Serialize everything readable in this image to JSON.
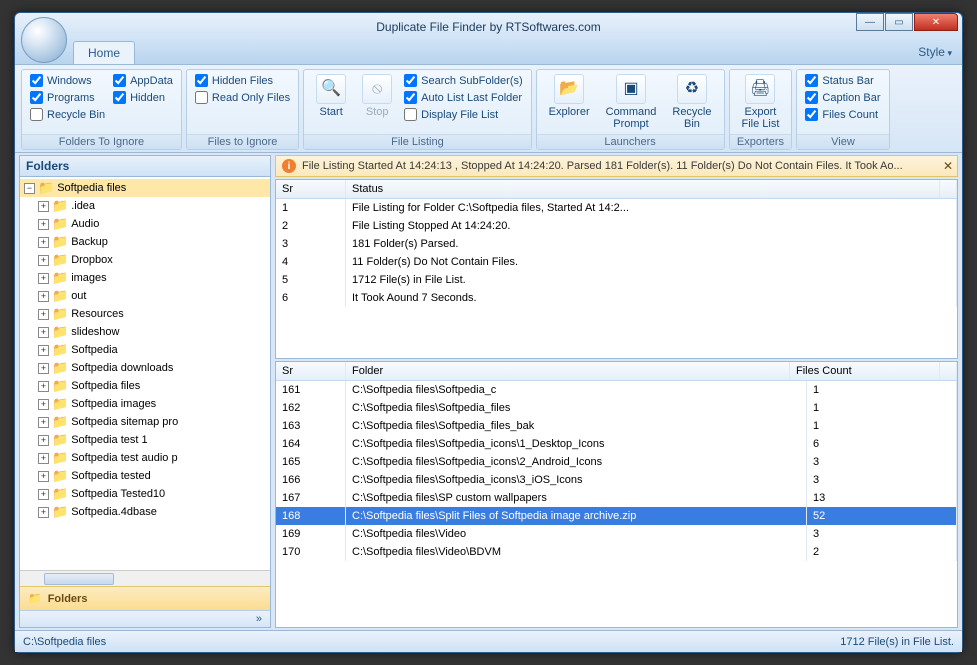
{
  "window": {
    "title": "Duplicate File Finder by RTSoftwares.com"
  },
  "tabs": {
    "home": "Home",
    "style": "Style"
  },
  "ribbon": {
    "folders_ignore": {
      "title": "Folders To Ignore",
      "windows": "Windows",
      "appdata": "AppData",
      "programs": "Programs",
      "hidden": "Hidden",
      "recycle": "Recycle Bin"
    },
    "files_ignore": {
      "title": "Files to Ignore",
      "hidden_files": "Hidden Files",
      "readonly": "Read Only Files"
    },
    "file_listing": {
      "title": "File Listing",
      "start": "Start",
      "stop": "Stop",
      "search_sub": "Search SubFolder(s)",
      "auto_list": "Auto List Last Folder",
      "display_list": "Display File List"
    },
    "launchers": {
      "title": "Launchers",
      "explorer": "Explorer",
      "cmd": "Command\nPrompt",
      "recycle": "Recycle\nBin"
    },
    "exporters": {
      "title": "Exporters",
      "export": "Export\nFile List"
    },
    "view": {
      "title": "View",
      "status_bar": "Status Bar",
      "caption_bar": "Caption Bar",
      "files_count": "Files Count"
    }
  },
  "folders_panel": {
    "title": "Folders",
    "root": "Softpedia files",
    "items": [
      ".idea",
      "Audio",
      "Backup",
      "Dropbox",
      "images",
      "out",
      "Resources",
      "slideshow",
      "Softpedia",
      "Softpedia downloads",
      "Softpedia files",
      "Softpedia images",
      "Softpedia sitemap pro",
      "Softpedia test 1",
      "Softpedia test audio p",
      "Softpedia tested",
      "Softpedia Tested10",
      "Softpedia.4dbase"
    ],
    "footer": "Folders"
  },
  "infobar": "File Listing Started At 14:24:13 , Stopped At 14:24:20. Parsed 181 Folder(s). 11 Folder(s) Do Not Contain Files. It Took Ao...",
  "status_grid": {
    "cols": {
      "sr": "Sr",
      "status": "Status"
    },
    "rows": [
      {
        "sr": "1",
        "status": "File Listing for Folder C:\\Softpedia files, Started At 14:2..."
      },
      {
        "sr": "2",
        "status": "File Listing Stopped At 14:24:20."
      },
      {
        "sr": "3",
        "status": "181 Folder(s) Parsed."
      },
      {
        "sr": "4",
        "status": "11 Folder(s) Do Not Contain Files."
      },
      {
        "sr": "5",
        "status": "1712 File(s) in File List."
      },
      {
        "sr": "6",
        "status": "It Took Aound 7 Seconds."
      }
    ]
  },
  "folder_grid": {
    "cols": {
      "sr": "Sr",
      "folder": "Folder",
      "count": "Files Count"
    },
    "rows": [
      {
        "sr": "161",
        "folder": "C:\\Softpedia files\\Softpedia_c",
        "count": "1"
      },
      {
        "sr": "162",
        "folder": "C:\\Softpedia files\\Softpedia_files",
        "count": "1"
      },
      {
        "sr": "163",
        "folder": "C:\\Softpedia files\\Softpedia_files_bak",
        "count": "1"
      },
      {
        "sr": "164",
        "folder": "C:\\Softpedia files\\Softpedia_icons\\1_Desktop_Icons",
        "count": "6"
      },
      {
        "sr": "165",
        "folder": "C:\\Softpedia files\\Softpedia_icons\\2_Android_Icons",
        "count": "3"
      },
      {
        "sr": "166",
        "folder": "C:\\Softpedia files\\Softpedia_icons\\3_iOS_Icons",
        "count": "3"
      },
      {
        "sr": "167",
        "folder": "C:\\Softpedia files\\SP custom wallpapers",
        "count": "13"
      },
      {
        "sr": "168",
        "folder": "C:\\Softpedia files\\Split Files of Softpedia image archive.zip",
        "count": "52",
        "selected": true
      },
      {
        "sr": "169",
        "folder": "C:\\Softpedia files\\Video",
        "count": "3"
      },
      {
        "sr": "170",
        "folder": "C:\\Softpedia files\\Video\\BDVM",
        "count": "2"
      }
    ]
  },
  "statusbar": {
    "left": "C:\\Softpedia files",
    "right": "1712 File(s) in File List."
  }
}
